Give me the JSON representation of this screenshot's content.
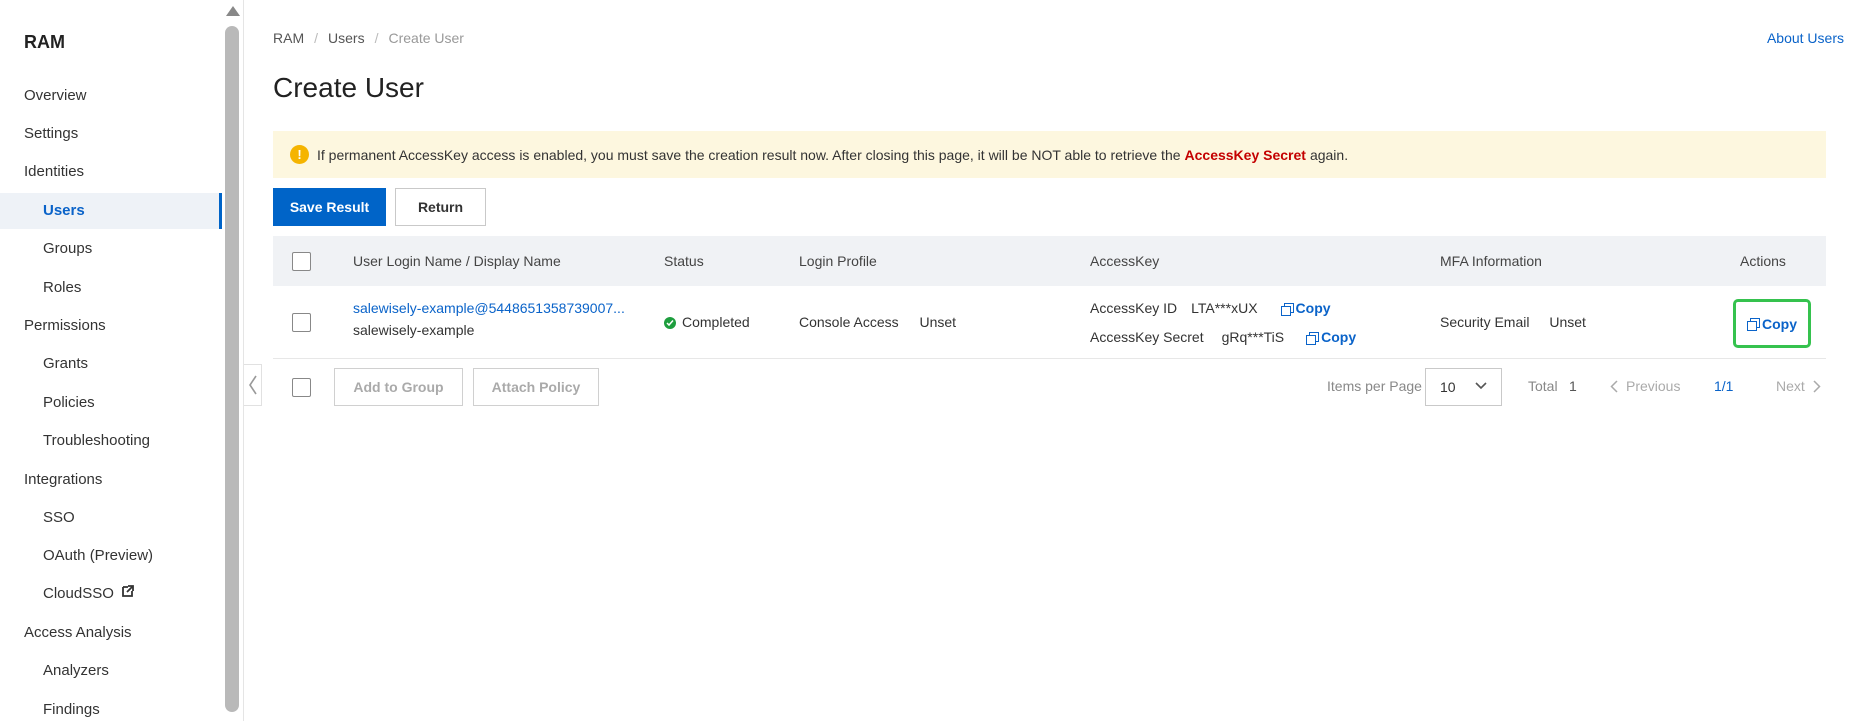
{
  "sidebar": {
    "title": "RAM",
    "items": [
      {
        "label": "Overview"
      },
      {
        "label": "Settings"
      },
      {
        "label": "Identities"
      },
      {
        "label": "Users"
      },
      {
        "label": "Groups"
      },
      {
        "label": "Roles"
      },
      {
        "label": "Permissions"
      },
      {
        "label": "Grants"
      },
      {
        "label": "Policies"
      },
      {
        "label": "Troubleshooting"
      },
      {
        "label": "Integrations"
      },
      {
        "label": "SSO"
      },
      {
        "label": "OAuth (Preview)"
      },
      {
        "label": "CloudSSO"
      },
      {
        "label": "Access Analysis"
      },
      {
        "label": "Analyzers"
      },
      {
        "label": "Findings"
      }
    ]
  },
  "breadcrumb": [
    "RAM",
    "Users",
    "Create User"
  ],
  "header": {
    "about_link": "About Users",
    "title": "Create User"
  },
  "alert": {
    "icon": "!",
    "text_before": "If permanent AccessKey access is enabled, you must save the creation result now. After closing this page, it will be NOT able to retrieve the",
    "emphasis": "AccessKey Secret",
    "text_after": "again."
  },
  "toolbar": {
    "save_label": "Save Result",
    "return_label": "Return"
  },
  "table": {
    "columns": [
      "User Login Name / Display Name",
      "Status",
      "Login Profile",
      "AccessKey",
      "MFA Information",
      "Actions"
    ],
    "row": {
      "login_name": "salewisely-example@5448651358739007...",
      "display_name": "salewisely-example",
      "status": "Completed",
      "login_profile_label": "Console Access",
      "login_profile_value": "Unset",
      "ak_id_label": "AccessKey ID",
      "ak_id_value": "LTA***xUX",
      "ak_secret_label": "AccessKey Secret",
      "ak_secret_value": "gRq***TiS",
      "copy_label": "Copy",
      "mfa_label": "Security Email",
      "mfa_value": "Unset",
      "action_label": "Copy"
    }
  },
  "footer": {
    "add_group_label": "Add to Group",
    "attach_policy_label": "Attach Policy",
    "items_per_page_label": "Items per Page",
    "items_per_page_value": "10",
    "total_label": "Total",
    "total_value": "1",
    "previous_label": "Previous",
    "page_indicator": "1/1",
    "next_label": "Next"
  },
  "colors": {
    "primary": "#0064c8",
    "link": "#0a63c9",
    "alert_bg": "#fdf7df",
    "alert_emphasis": "#c40000",
    "success": "#1e9e3e",
    "highlight": "#35c24e"
  }
}
